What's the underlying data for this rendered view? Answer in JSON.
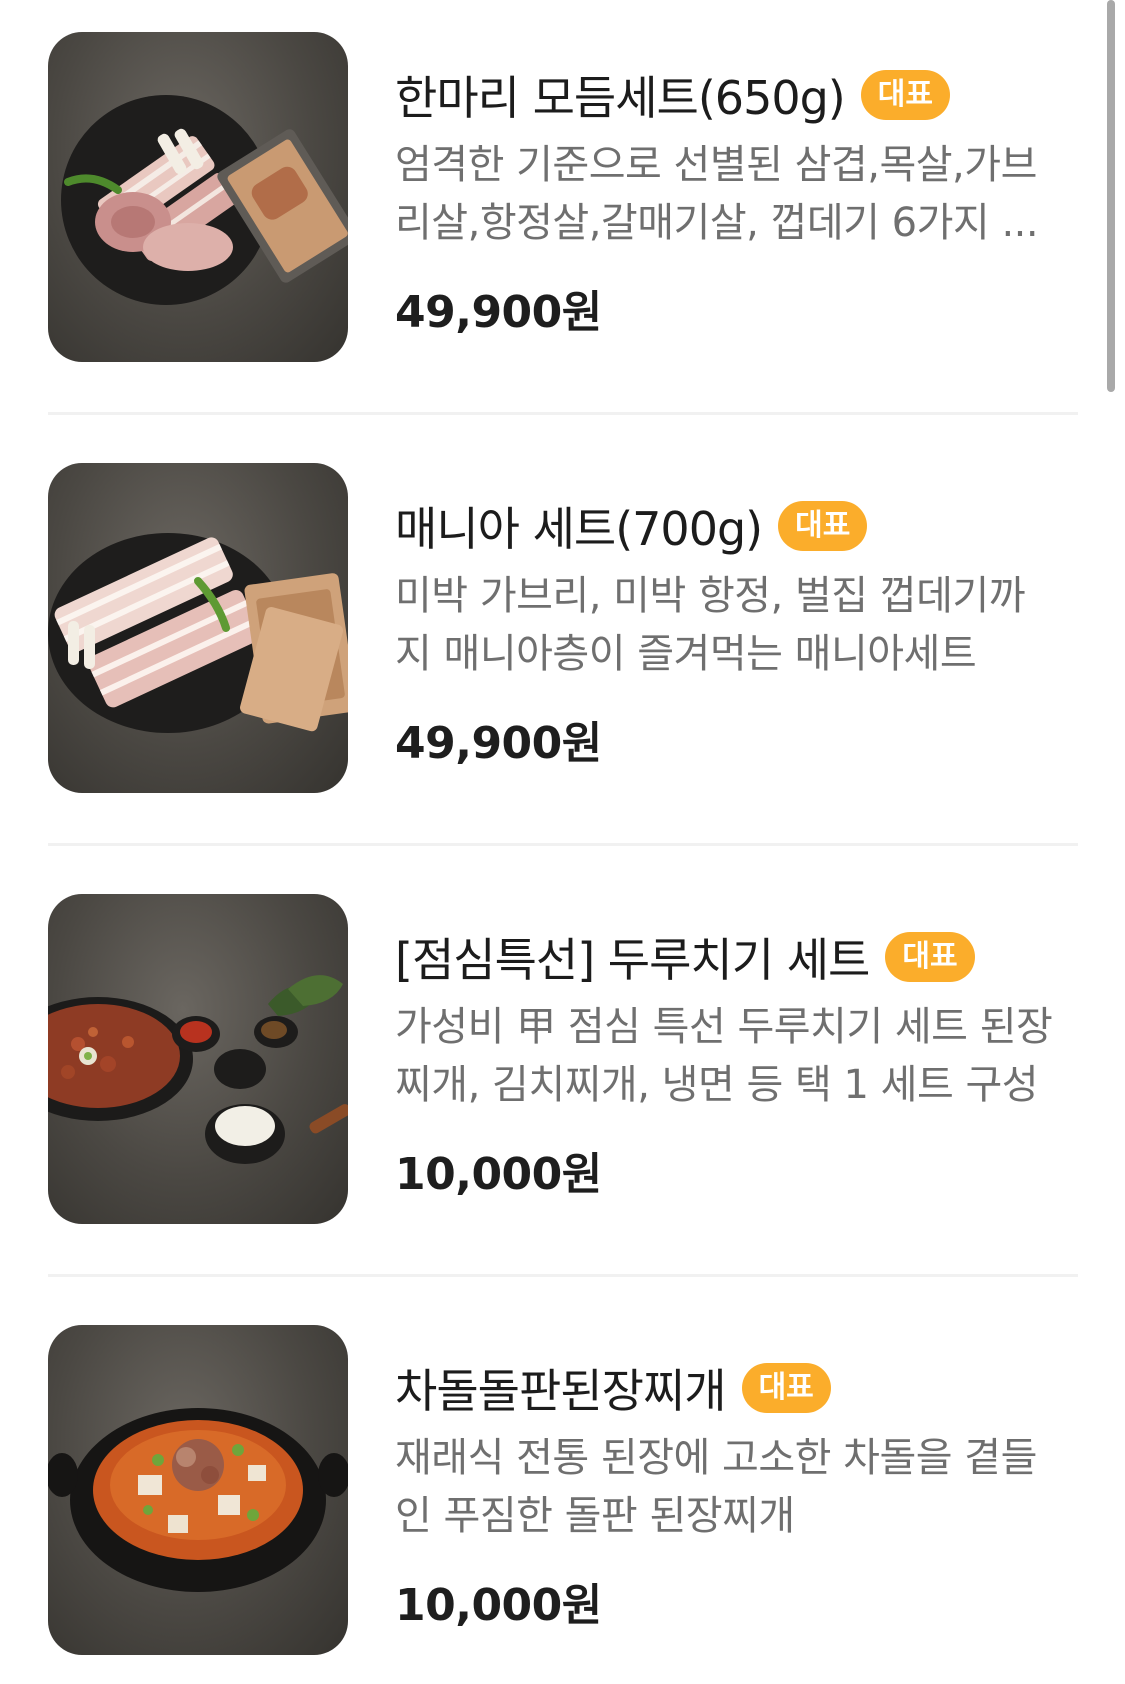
{
  "menu": {
    "items": [
      {
        "name": "한마리 모듬세트(650g)",
        "badge": "대표",
        "desc_line1": "엄격한 기준으로 선별된 삼겹,목살,가브",
        "desc_line2": "리살,항정살,갈매기살, 껍데기 6가지 ...",
        "price": "49,900원",
        "image": "pork-platter-photo"
      },
      {
        "name": "매니아 세트(700g)",
        "badge": "대표",
        "desc_line1": "미박 가브리, 미박 항정, 벌집 껍데기까",
        "desc_line2": "지 매니아층이 즐겨먹는 매니아세트",
        "price": "49,900원",
        "image": "pork-set-photo"
      },
      {
        "name": "[점심특선] 두루치기 세트",
        "badge": "대표",
        "desc_line1": "가성비 甲 점심 특선 두루치기 세트 된장",
        "desc_line2": "찌개, 김치찌개, 냉면 등 택 1 세트 구성",
        "price": "10,000원",
        "image": "duruchigi-set-photo"
      },
      {
        "name": "차돌돌판된장찌개",
        "badge": "대표",
        "desc_line1": "재래식 전통 된장에 고소한 차돌을 곁들",
        "desc_line2": "인 푸짐한 돌판 된장찌개",
        "price": "10,000원",
        "image": "doenjang-stew-photo"
      }
    ]
  },
  "colors": {
    "badge_bg": "#fbad2b",
    "badge_text": "#ffffff",
    "desc_text": "#6f6f6f",
    "divider": "#f1f1f1"
  }
}
